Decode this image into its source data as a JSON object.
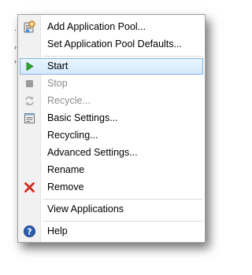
{
  "menu": {
    "items": [
      {
        "label": "Add Application Pool...",
        "icon": "app-pool-add-icon",
        "enabled": true
      },
      {
        "label": "Set Application Pool Defaults...",
        "icon": "",
        "enabled": true
      },
      {
        "label": "Start",
        "icon": "play-icon",
        "enabled": true,
        "highlighted": true
      },
      {
        "label": "Stop",
        "icon": "stop-icon",
        "enabled": false
      },
      {
        "label": "Recycle...",
        "icon": "recycle-icon",
        "enabled": false
      },
      {
        "label": "Basic Settings...",
        "icon": "settings-page-icon",
        "enabled": true
      },
      {
        "label": "Recycling...",
        "icon": "",
        "enabled": true
      },
      {
        "label": "Advanced Settings...",
        "icon": "",
        "enabled": true
      },
      {
        "label": "Rename",
        "icon": "",
        "enabled": true
      },
      {
        "label": "Remove",
        "icon": "remove-x-icon",
        "enabled": true
      },
      {
        "label": "View Applications",
        "icon": "",
        "enabled": true
      },
      {
        "label": "Help",
        "icon": "help-icon",
        "enabled": true
      }
    ]
  },
  "colors": {
    "highlight_border": "#7fb4e5",
    "start_green": "#2fa82f",
    "remove_red": "#d22b1f",
    "help_blue": "#2a5db0",
    "disabled_text": "#8d8d8d"
  }
}
